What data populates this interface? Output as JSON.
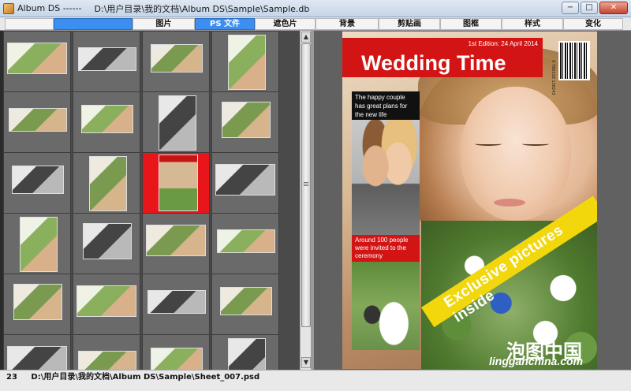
{
  "window": {
    "app_name": "Album DS ------",
    "path": "D:\\用户目录\\我的文档\\Album DS\\Sample\\Sample.db",
    "minimize_glyph": "−",
    "maximize_glyph": "□",
    "close_glyph": "✕"
  },
  "tabs": [
    {
      "label": "图片",
      "active": false
    },
    {
      "label": "PS 文件",
      "active": true
    },
    {
      "label": "遮色片",
      "active": false
    },
    {
      "label": "背景",
      "active": false
    },
    {
      "label": "剪贴画",
      "active": false
    },
    {
      "label": "图框",
      "active": false
    },
    {
      "label": "样式",
      "active": false
    },
    {
      "label": "变化",
      "active": false
    }
  ],
  "grid": {
    "selected_index": 10,
    "rows": 6,
    "cols": 4
  },
  "scrollbar": {
    "up_glyph": "▲",
    "down_glyph": "▼"
  },
  "cover": {
    "edition": "1st Edition: 24 April 2014",
    "headline": "Wedding Time",
    "teaser": "The happy couple has great plans for the new life",
    "guests": "Around 100 people were invited to the ceremony",
    "banner": "Exclusive pictures inside",
    "barcode_text": "9 780318 138243"
  },
  "status": {
    "index": "23",
    "path": "D:\\用户目录\\我的文档\\Album DS\\Sample\\Sheet_007.psd"
  },
  "watermark": {
    "cn": "泡图中国",
    "site": "lingganchina.com"
  },
  "colors": {
    "accent_blue": "#3c8ff0",
    "headline_red": "#d21414",
    "banner_yellow": "#f2d70c"
  }
}
